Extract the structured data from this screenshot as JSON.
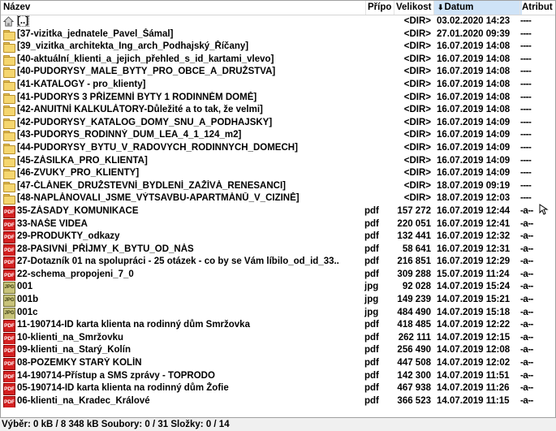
{
  "columns": {
    "name": "Název",
    "ext": "Přípo",
    "size": "Velikost",
    "date": "Datum",
    "attr": "Atribut",
    "sort_icon": "sort-down-arrow-icon"
  },
  "rows": [
    {
      "icon": "up-dir",
      "name": "[..]",
      "ext": "",
      "size": "<DIR>",
      "date": "03.02.2020 14:23",
      "attr": "----"
    },
    {
      "icon": "folder",
      "name": "[37-vizitka_jednatele_Pavel_Šámal]",
      "ext": "",
      "size": "<DIR>",
      "date": "27.01.2020 09:39",
      "attr": "----"
    },
    {
      "icon": "folder",
      "name": "[39_vizitka_architekta_Ing_arch_Podhajský_Říčany]",
      "ext": "",
      "size": "<DIR>",
      "date": "16.07.2019 14:08",
      "attr": "----"
    },
    {
      "icon": "folder",
      "name": "[40-aktuální_klienti_a_jejich_přehled_s_id_kartami_vlevo]",
      "ext": "",
      "size": "<DIR>",
      "date": "16.07.2019 14:08",
      "attr": "----"
    },
    {
      "icon": "folder",
      "name": "[40-PUDORYSY_MALE_BYTY_PRO_OBCE_A_DRUŽSTVA]",
      "ext": "",
      "size": "<DIR>",
      "date": "16.07.2019 14:08",
      "attr": "----"
    },
    {
      "icon": "folder",
      "name": "[41-KATALOGY - pro_klienty]",
      "ext": "",
      "size": "<DIR>",
      "date": "16.07.2019 14:08",
      "attr": "----"
    },
    {
      "icon": "folder",
      "name": "[41-PUDORYS 3 PŘÍZEMNÍ BYTY 1 RODINNÉM DOMĚ]",
      "ext": "",
      "size": "<DIR>",
      "date": "16.07.2019 14:08",
      "attr": "----"
    },
    {
      "icon": "folder",
      "name": "[42-ANUITNÍ KALKULÁTORY-Důležité a to tak, že velmi]",
      "ext": "",
      "size": "<DIR>",
      "date": "16.07.2019 14:08",
      "attr": "----"
    },
    {
      "icon": "folder",
      "name": "[42-PUDORYSY_KATALOG_DOMY_SNU_A_PODHAJSKY]",
      "ext": "",
      "size": "<DIR>",
      "date": "16.07.2019 14:09",
      "attr": "----"
    },
    {
      "icon": "folder",
      "name": "[43-PUDORYS_RODINNÝ_DUM_LEA_4_1_124_m2]",
      "ext": "",
      "size": "<DIR>",
      "date": "16.07.2019 14:09",
      "attr": "----"
    },
    {
      "icon": "folder",
      "name": "[44-PUDORYSY_BYTU_V_RADOVYCH_RODINNYCH_DOMECH]",
      "ext": "",
      "size": "<DIR>",
      "date": "16.07.2019 14:09",
      "attr": "----"
    },
    {
      "icon": "folder",
      "name": "[45-ZÁSILKA_PRO_KLIENTA]",
      "ext": "",
      "size": "<DIR>",
      "date": "16.07.2019 14:09",
      "attr": "----"
    },
    {
      "icon": "folder",
      "name": "[46-ZVUKY_PRO_KLIENTY]",
      "ext": "",
      "size": "<DIR>",
      "date": "16.07.2019 14:09",
      "attr": "----"
    },
    {
      "icon": "folder",
      "name": "[47-ČLÁNEK_DRUŽSTEVNÍ_BYDLENÍ_ZAŽÍVÁ_RENESANCI]",
      "ext": "",
      "size": "<DIR>",
      "date": "18.07.2019 09:19",
      "attr": "----"
    },
    {
      "icon": "folder",
      "name": "[48-NAPLÁNOVALI_JSME_VÝTSAVBU-APARTMÁNŮ_V_CIZINĚ]",
      "ext": "",
      "size": "<DIR>",
      "date": "18.07.2019 12:03",
      "attr": "----"
    },
    {
      "icon": "pdf",
      "name": "35-ZÁSADY_KOMUNIKACE",
      "ext": "pdf",
      "size": "157 272",
      "date": "16.07.2019 12:44",
      "attr": "-a--"
    },
    {
      "icon": "pdf",
      "name": "33-NAŠE VIDEA",
      "ext": "pdf",
      "size": "220 051",
      "date": "16.07.2019 12:41",
      "attr": "-a--"
    },
    {
      "icon": "pdf",
      "name": "29-PRODUKTY_odkazy",
      "ext": "pdf",
      "size": "132 441",
      "date": "16.07.2019 12:32",
      "attr": "-a--"
    },
    {
      "icon": "pdf",
      "name": "28-PASIVNÍ_PŘÍJMY_K_BYTU_OD_NÁS",
      "ext": "pdf",
      "size": "58 641",
      "date": "16.07.2019 12:31",
      "attr": "-a--"
    },
    {
      "icon": "pdf",
      "name": "27-Dotazník 01 na spolupráci - 25 otázek - co by se Vám líbilo_od_id_33..",
      "ext": "pdf",
      "size": "216 851",
      "date": "16.07.2019 12:29",
      "attr": "-a--"
    },
    {
      "icon": "pdf",
      "name": "22-schema_propojeni_7_0",
      "ext": "pdf",
      "size": "309 288",
      "date": "15.07.2019 11:24",
      "attr": "-a--"
    },
    {
      "icon": "jpg",
      "name": "001",
      "ext": "jpg",
      "size": "92 028",
      "date": "14.07.2019 15:24",
      "attr": "-a--"
    },
    {
      "icon": "jpg",
      "name": "001b",
      "ext": "jpg",
      "size": "149 239",
      "date": "14.07.2019 15:21",
      "attr": "-a--"
    },
    {
      "icon": "jpg",
      "name": "001c",
      "ext": "jpg",
      "size": "484 490",
      "date": "14.07.2019 15:18",
      "attr": "-a--"
    },
    {
      "icon": "pdf",
      "name": "11-190714-ID karta klienta na rodinný dům Smržovka",
      "ext": "pdf",
      "size": "418 485",
      "date": "14.07.2019 12:22",
      "attr": "-a--"
    },
    {
      "icon": "pdf",
      "name": "10-klienti_na_Smržovku",
      "ext": "pdf",
      "size": "262 111",
      "date": "14.07.2019 12:15",
      "attr": "-a--"
    },
    {
      "icon": "pdf",
      "name": "09-klienti_na_Starý_Kolín",
      "ext": "pdf",
      "size": "256 490",
      "date": "14.07.2019 12:08",
      "attr": "-a--"
    },
    {
      "icon": "pdf",
      "name": "08-POZEMKY STARÝ KOLÍN",
      "ext": "pdf",
      "size": "447 508",
      "date": "14.07.2019 12:02",
      "attr": "-a--"
    },
    {
      "icon": "pdf",
      "name": "14-190714-Přístup a SMS zprávy - TOPRODO",
      "ext": "pdf",
      "size": "142 300",
      "date": "14.07.2019 11:51",
      "attr": "-a--"
    },
    {
      "icon": "pdf",
      "name": "05-190714-ID karta klienta na rodinný dům Žofie",
      "ext": "pdf",
      "size": "467 938",
      "date": "14.07.2019 11:26",
      "attr": "-a--"
    },
    {
      "icon": "pdf",
      "name": "06-klienti_na_Kradec_Králové",
      "ext": "pdf",
      "size": "366 523",
      "date": "14.07.2019 11:15",
      "attr": "-a--"
    }
  ],
  "status": {
    "text": "Výběr: 0 kB / 8 348 kB   Soubory: 0 / 31   Složky: 0 / 14"
  }
}
